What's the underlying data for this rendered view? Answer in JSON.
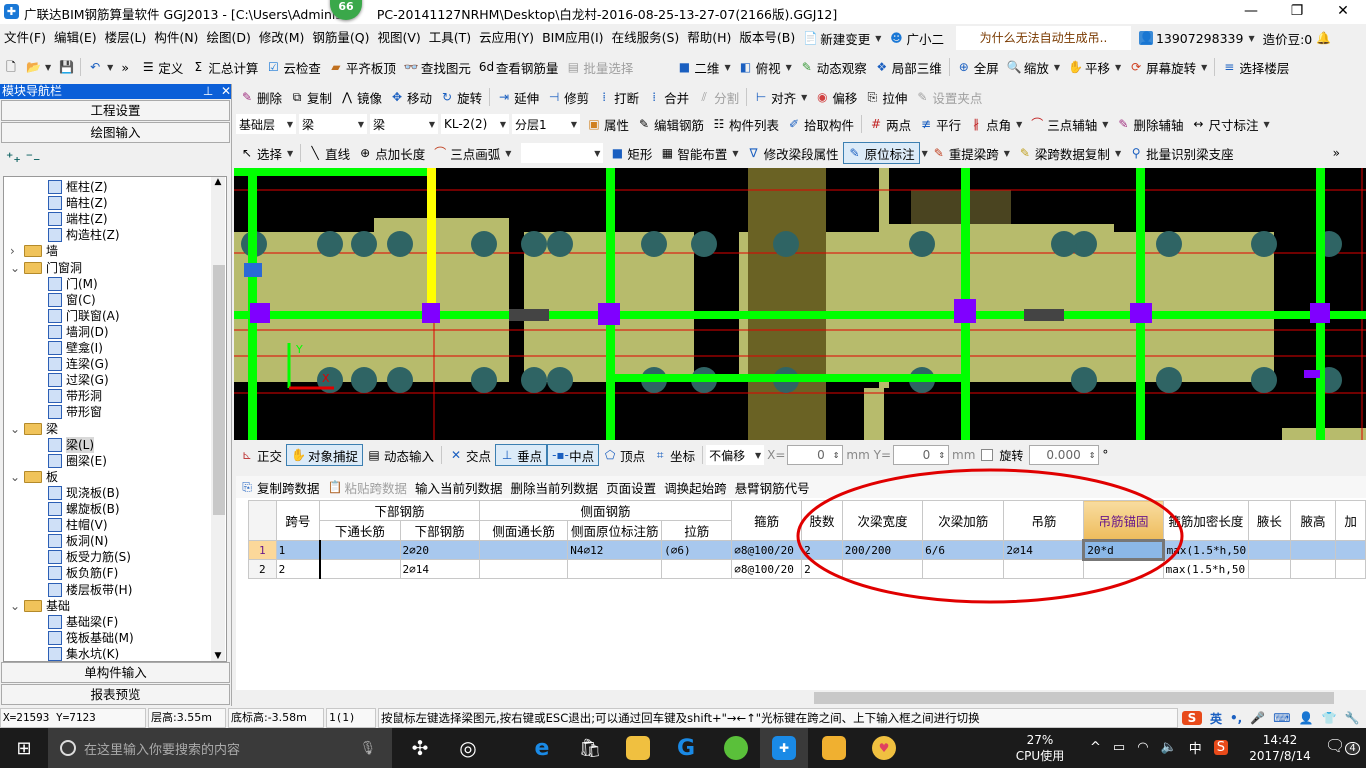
{
  "window": {
    "title": "广联达BIM钢筋算量软件 GGJ2013 - [C:\\Users\\Administ",
    "title_rest": "PC-20141127NRHM\\Desktop\\白龙村-2016-08-25-13-27-07(2166版).GGJ12]",
    "badge": "66"
  },
  "menu": [
    "文件(F)",
    "编辑(E)",
    "楼层(L)",
    "构件(N)",
    "绘图(D)",
    "修改(M)",
    "钢筋量(Q)",
    "视图(V)",
    "工具(T)",
    "云应用(Y)",
    "BIM应用(I)",
    "在线服务(S)",
    "帮助(H)",
    "版本号(B)"
  ],
  "menu_extra": {
    "new_change": "新建变更",
    "assistant": "广小二",
    "question": "为什么无法自动生成吊..",
    "phone": "13907298339",
    "beans": "造价豆:0"
  },
  "toolbar1": {
    "left": [
      "定义",
      "汇总计算",
      "云检查",
      "平齐板顶",
      "查找图元",
      "查看钢筋量",
      "批量选择"
    ],
    "right": [
      "二维",
      "俯视",
      "动态观察",
      "局部三维",
      "全屏",
      "缩放",
      "平移",
      "屏幕旋转",
      "选择楼层"
    ]
  },
  "toolbar2": [
    "删除",
    "复制",
    "镜像",
    "移动",
    "旋转",
    "延伸",
    "修剪",
    "打断",
    "合并",
    "分割",
    "对齐",
    "偏移",
    "拉伸",
    "设置夹点"
  ],
  "toolbar3": {
    "combos": [
      "基础层",
      "梁",
      "梁",
      "KL-2(2)",
      "分层1"
    ],
    "buttons": [
      "属性",
      "编辑钢筋",
      "构件列表",
      "拾取构件",
      "两点",
      "平行",
      "点角",
      "三点辅轴",
      "删除辅轴",
      "尺寸标注"
    ]
  },
  "toolbar4": [
    "选择",
    "直线",
    "点加长度",
    "三点画弧",
    "矩形",
    "智能布置",
    "修改梁段属性",
    "原位标注",
    "重提梁跨",
    "梁跨数据复制",
    "批量识别梁支座"
  ],
  "nav": {
    "title": "模块导航栏",
    "btn_settings": "工程设置",
    "btn_draw": "绘图输入",
    "btn_single": "单构件输入",
    "btn_report": "报表预览",
    "tree": [
      {
        "label": "框柱(Z)",
        "level": 2
      },
      {
        "label": "暗柱(Z)",
        "level": 2
      },
      {
        "label": "端柱(Z)",
        "level": 2
      },
      {
        "label": "构造柱(Z)",
        "level": 2
      },
      {
        "label": "墙",
        "level": 1,
        "state": "collapsed"
      },
      {
        "label": "门窗洞",
        "level": 1,
        "state": "expanded"
      },
      {
        "label": "门(M)",
        "level": 2
      },
      {
        "label": "窗(C)",
        "level": 2
      },
      {
        "label": "门联窗(A)",
        "level": 2
      },
      {
        "label": "墙洞(D)",
        "level": 2
      },
      {
        "label": "壁龛(I)",
        "level": 2
      },
      {
        "label": "连梁(G)",
        "level": 2
      },
      {
        "label": "过梁(G)",
        "level": 2
      },
      {
        "label": "带形洞",
        "level": 2
      },
      {
        "label": "带形窗",
        "level": 2
      },
      {
        "label": "梁",
        "level": 1,
        "state": "expanded"
      },
      {
        "label": "梁(L)",
        "level": 2,
        "selected": true
      },
      {
        "label": "圈梁(E)",
        "level": 2
      },
      {
        "label": "板",
        "level": 1,
        "state": "expanded"
      },
      {
        "label": "现浇板(B)",
        "level": 2
      },
      {
        "label": "螺旋板(B)",
        "level": 2
      },
      {
        "label": "柱帽(V)",
        "level": 2
      },
      {
        "label": "板洞(N)",
        "level": 2
      },
      {
        "label": "板受力筋(S)",
        "level": 2
      },
      {
        "label": "板负筋(F)",
        "level": 2
      },
      {
        "label": "楼层板带(H)",
        "level": 2
      },
      {
        "label": "基础",
        "level": 1,
        "state": "expanded"
      },
      {
        "label": "基础梁(F)",
        "level": 2
      },
      {
        "label": "筏板基础(M)",
        "level": 2
      },
      {
        "label": "集水坑(K)",
        "level": 2
      }
    ]
  },
  "snapbar": {
    "items": [
      "正交",
      "对象捕捉",
      "动态输入",
      "交点",
      "垂点",
      "中点",
      "顶点",
      "坐标"
    ],
    "offset": "不偏移",
    "x_label": "X=",
    "x_value": "0",
    "y_label": "Y=",
    "y_value": "0",
    "unit": "mm",
    "rotate_label": "旋转",
    "rotate_value": "0.000",
    "degree": "°"
  },
  "gridbar": [
    "复制跨数据",
    "粘贴跨数据",
    "输入当前列数据",
    "删除当前列数据",
    "页面设置",
    "调换起始跨",
    "悬臂钢筋代号"
  ],
  "table": {
    "group_headers": {
      "bottom": "下部钢筋",
      "side": "侧面钢筋"
    },
    "headers": [
      "跨号",
      "下通长筋",
      "下部钢筋",
      "侧面通长筋",
      "侧面原位标注筋",
      "拉筋",
      "箍筋",
      "肢数",
      "次梁宽度",
      "次梁加筋",
      "吊筋",
      "吊筋锚固",
      "箍筋加密长度",
      "腋长",
      "腋高",
      "加"
    ],
    "rows": [
      {
        "n": "1",
        "cells": [
          "1",
          "",
          "2⌀20",
          "",
          "N4⌀12",
          "(⌀6)",
          "⌀8@100/20",
          "2",
          "200/200",
          "6/6",
          "2⌀14",
          "20*d",
          "max(1.5*h,50",
          "",
          "",
          ""
        ],
        "selected": true
      },
      {
        "n": "2",
        "cells": [
          "2",
          "",
          "2⌀14",
          "",
          "",
          "",
          "⌀8@100/20",
          "2",
          "",
          "",
          "",
          "",
          "max(1.5*h,50",
          "",
          "",
          ""
        ]
      }
    ]
  },
  "status": {
    "coords": "X=21593 Y=7123",
    "floor_height": "层高:3.55m",
    "bottom_elev": "底标高:-3.58m",
    "count": "1(1)",
    "hint": "按鼠标左键选择梁图元,按右键或ESC退出;可以通过回车键及shift+\"→←↑\"光标键在跨之间、上下输入框之间进行切换",
    "ime": "英"
  },
  "taskbar": {
    "search_placeholder": "在这里输入你要搜索的内容",
    "cpu_pct": "27%",
    "cpu_label": "CPU使用",
    "ime": "中",
    "time": "14:42",
    "date": "2017/8/14",
    "notifications": "4"
  },
  "colors": {
    "beam": "#00ff00",
    "slab": "#b7bb6c",
    "column": "#2f6464",
    "annotation": "#e00000",
    "nav_header": "#0b5fd8",
    "selected_row": "#a8c8ee"
  }
}
